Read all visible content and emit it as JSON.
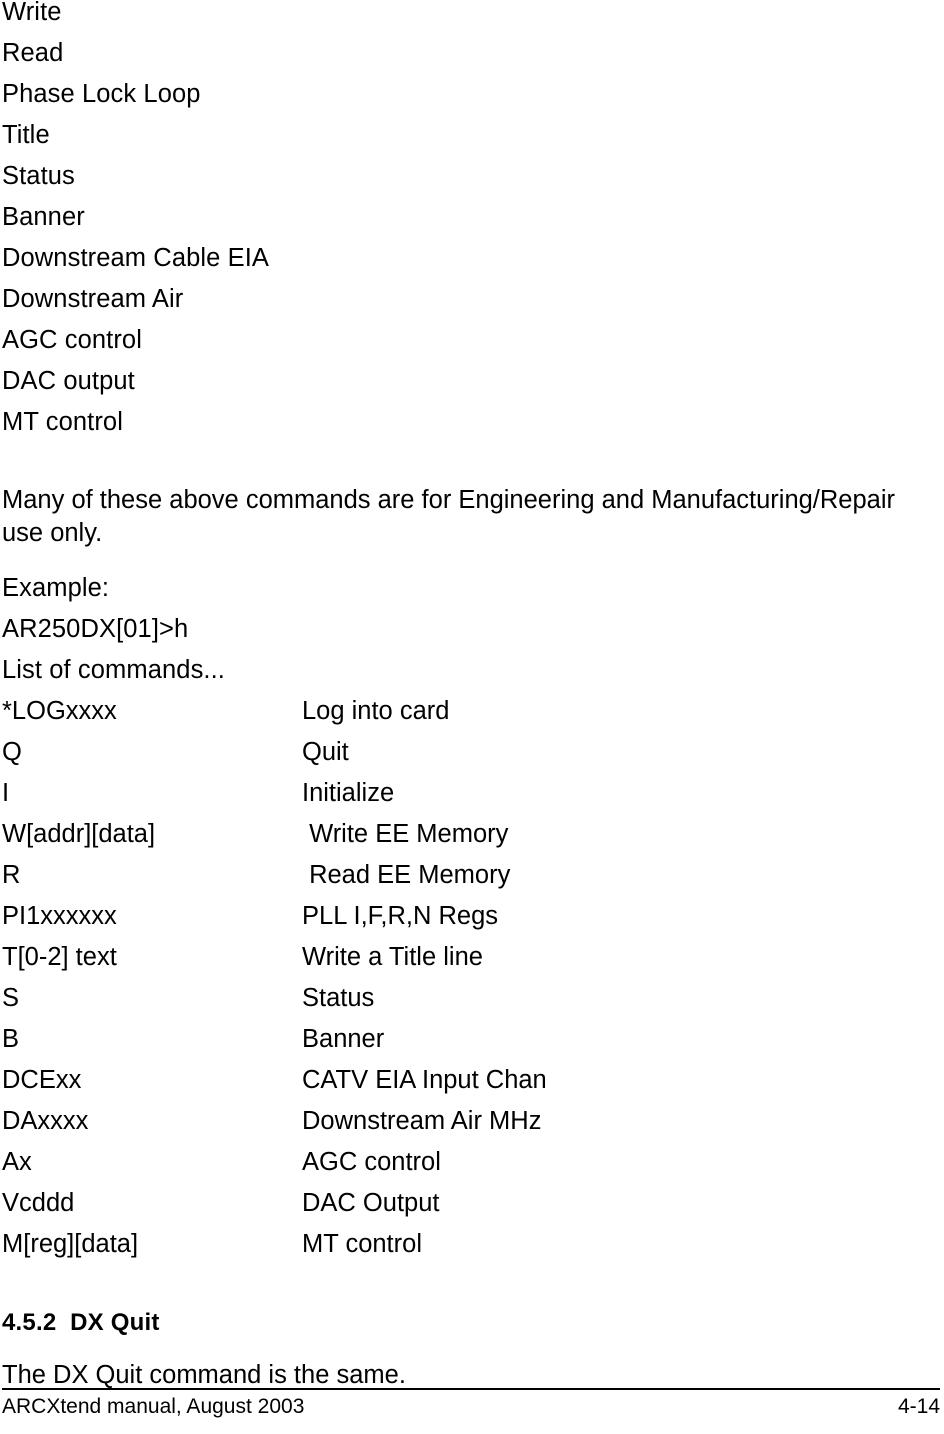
{
  "document": {
    "command_summary_list": [
      "Write",
      "Read",
      "Phase Lock Loop",
      "Title",
      "Status",
      "Banner",
      "Downstream Cable EIA",
      "Downstream Air",
      "AGC control",
      "DAC output",
      "MT control"
    ],
    "note_paragraph": "Many of these above commands are for Engineering and Manufacturing/Repair use only.",
    "example_label": "Example:",
    "example_prompt": "AR250DX[01]>h",
    "example_response": "List of commands...",
    "command_reference": {
      "rows": [
        {
          "command": "*LOGxxxx",
          "description": "Log into card"
        },
        {
          "command": "Q",
          "description": "Quit"
        },
        {
          "command": "I",
          "description": "Initialize"
        },
        {
          "command": "W[addr][data]",
          "description": " Write EE Memory"
        },
        {
          "command": "R",
          "description": " Read EE Memory"
        },
        {
          "command": "PI1xxxxxx",
          "description": "PLL I,F,R,N Regs"
        },
        {
          "command": "T[0-2] text",
          "description": "Write a Title line"
        },
        {
          "command": "S",
          "description": "Status"
        },
        {
          "command": "B",
          "description": "Banner"
        },
        {
          "command": "DCExx",
          "description": "CATV EIA Input Chan"
        },
        {
          "command": "DAxxxx",
          "description": "Downstream Air MHz"
        },
        {
          "command": "Ax",
          "description": "AGC control"
        },
        {
          "command": "Vcddd",
          "description": "DAC Output"
        },
        {
          "command": "M[reg][data]",
          "description": "MT control"
        }
      ]
    },
    "section": {
      "number": "4.5.2",
      "title": "DX Quit",
      "heading_full": "4.5.2  DX Quit",
      "body": "The DX Quit command is the same."
    }
  },
  "footer": {
    "manual_title": "ARCXtend manual, August 2003",
    "page_number": "4-14"
  },
  "colors": {
    "text": "#000000",
    "background": "#ffffff",
    "rule": "#000000"
  }
}
